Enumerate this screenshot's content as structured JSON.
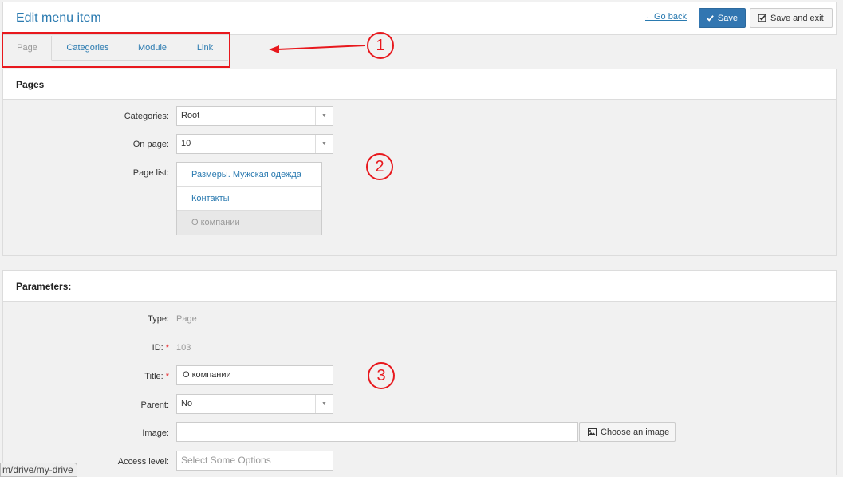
{
  "header": {
    "title": "Edit menu item",
    "go_back": "←Go back",
    "save_label": "Save",
    "save_exit_label": "Save and exit"
  },
  "tabs": [
    {
      "label": "Page",
      "active": true
    },
    {
      "label": "Categories",
      "active": false
    },
    {
      "label": "Module",
      "active": false
    },
    {
      "label": "Link",
      "active": false
    }
  ],
  "pages_panel": {
    "title": "Pages",
    "categories_label": "Categories:",
    "categories_value": "Root",
    "on_page_label": "On page:",
    "on_page_value": "10",
    "page_list_label": "Page list:",
    "page_list": [
      {
        "label": "Размеры. Мужская одежда",
        "disabled": false
      },
      {
        "label": "Контакты",
        "disabled": false
      },
      {
        "label": "О компании",
        "disabled": true
      }
    ]
  },
  "params_panel": {
    "title": "Parameters:",
    "type_label": "Type:",
    "type_value": "Page",
    "id_label": "ID:",
    "id_value": "103",
    "title_label": "Title:",
    "title_value": "О компании",
    "parent_label": "Parent:",
    "parent_value": "No",
    "image_label": "Image:",
    "image_value": "",
    "choose_image_label": "Choose an image",
    "access_label": "Access level:",
    "access_placeholder": "Select Some Options",
    "required_mark": "*"
  },
  "annotations": {
    "marker_1": "1",
    "marker_2": "2",
    "marker_3": "3",
    "color": "#e8181d"
  },
  "status_bar": {
    "url": "m/drive/my-drive"
  },
  "colors": {
    "accent": "#2a7ab0",
    "primary_button": "#3276b1",
    "background": "#f1f1f1"
  }
}
